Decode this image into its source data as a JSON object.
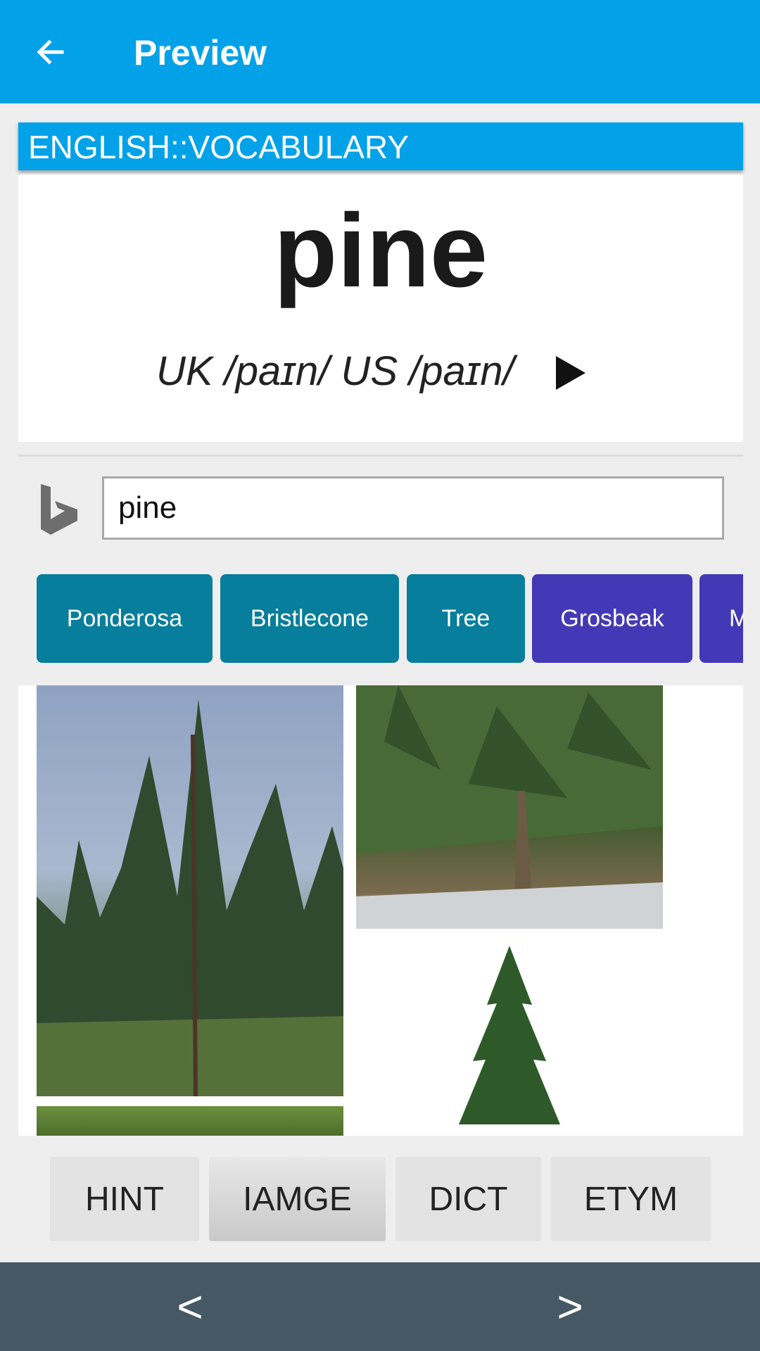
{
  "appbar": {
    "title": "Preview",
    "back_icon": "arrow-back-icon"
  },
  "deck": {
    "name": "ENGLISH::VOCABULARY"
  },
  "card": {
    "word": "pine",
    "pronunciation": "UK /paɪn/ US /paɪn/",
    "play_icon": "play-icon"
  },
  "search": {
    "engine_icon": "bing-icon",
    "query": "pine"
  },
  "related": [
    {
      "label": "Ponderosa",
      "color": "#077e9b"
    },
    {
      "label": "Bristlecone",
      "color": "#077e9b"
    },
    {
      "label": "Tree",
      "color": "#077e9b"
    },
    {
      "label": "Grosbeak",
      "color": "#4339b6"
    },
    {
      "label": "M",
      "color": "#4339b6"
    }
  ],
  "tabs": [
    {
      "label": "HINT",
      "active": false
    },
    {
      "label": "IAMGE",
      "active": true
    },
    {
      "label": "DICT",
      "active": false
    },
    {
      "label": "ETYM",
      "active": false
    }
  ],
  "nav": {
    "prev_label": "<",
    "next_label": ">"
  },
  "colors": {
    "primary": "#03a2e8",
    "teal": "#077e9b",
    "purple": "#4339b6",
    "navbar": "#455864"
  }
}
